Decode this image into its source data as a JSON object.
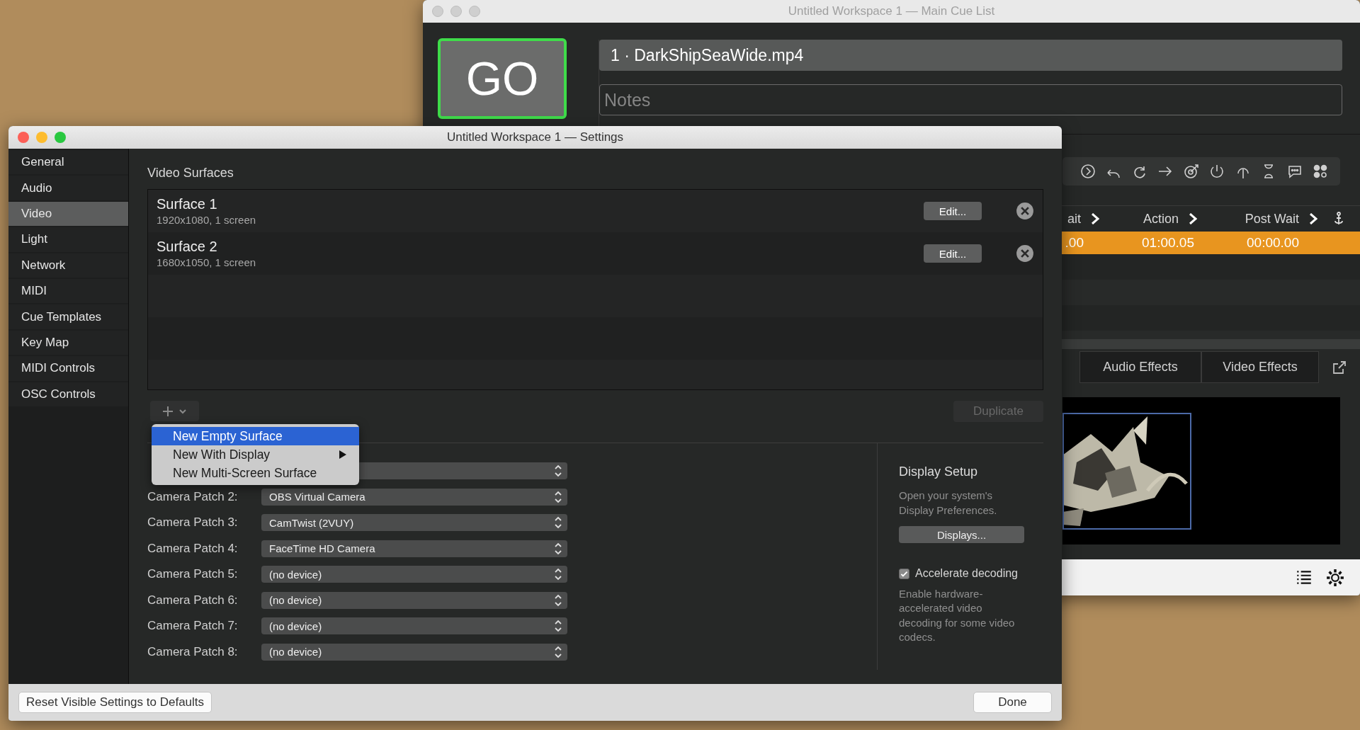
{
  "main_window": {
    "title": "Untitled Workspace 1 — Main Cue List",
    "go_label": "GO",
    "cue_name": "1 · DarkShipSeaWide.mp4",
    "notes_placeholder": "Notes",
    "columns": [
      "ait",
      "Action",
      "Post Wait"
    ],
    "cue_row": {
      "selected": true,
      "cells": [
        ".00",
        "01:00.05",
        "00:00.00"
      ]
    },
    "inspector_tabs": [
      {
        "label": "Audio Effects",
        "selected": false
      },
      {
        "label": "Video Effects",
        "selected": false
      }
    ]
  },
  "settings_window": {
    "title": "Untitled Workspace 1 — Settings",
    "sidebar": [
      {
        "label": "General",
        "selected": false
      },
      {
        "label": "Audio",
        "selected": false
      },
      {
        "label": "Video",
        "selected": true
      },
      {
        "label": "Light",
        "selected": false
      },
      {
        "label": "Network",
        "selected": false
      },
      {
        "label": "MIDI",
        "selected": false
      },
      {
        "label": "Cue Templates",
        "selected": false
      },
      {
        "label": "Key Map",
        "selected": false
      },
      {
        "label": "MIDI Controls",
        "selected": false
      },
      {
        "label": "OSC Controls",
        "selected": false
      }
    ],
    "section_title": "Video Surfaces",
    "surfaces": [
      {
        "name": "Surface 1",
        "detail": "1920x1080, 1 screen",
        "edit_label": "Edit..."
      },
      {
        "name": "Surface 2",
        "detail": "1680x1050, 1 screen",
        "edit_label": "Edit..."
      }
    ],
    "duplicate": {
      "label": "Duplicate",
      "disabled": true
    },
    "add_menu": [
      {
        "label": "New Empty Surface",
        "selected": true,
        "submenu": false
      },
      {
        "label": "New With Display",
        "selected": false,
        "submenu": true
      },
      {
        "label": "New Multi-Screen Surface",
        "selected": false,
        "submenu": false
      }
    ],
    "camera_patches": [
      {
        "label": "Camera Patch 2:",
        "value": "OBS Virtual Camera"
      },
      {
        "label": "Camera Patch 3:",
        "value": "CamTwist (2VUY)"
      },
      {
        "label": "Camera Patch 4:",
        "value": "FaceTime HD Camera"
      },
      {
        "label": "Camera Patch 5:",
        "value": "(no device)"
      },
      {
        "label": "Camera Patch 6:",
        "value": "(no device)"
      },
      {
        "label": "Camera Patch 7:",
        "value": "(no device)"
      },
      {
        "label": "Camera Patch 8:",
        "value": "(no device)"
      }
    ],
    "display_setup": {
      "title": "Display Setup",
      "description": "Open your system's Display Preferences.",
      "button": "Displays...",
      "checkbox": {
        "label": "Accelerate decoding",
        "checked": true
      },
      "hint": "Enable hardware-accelerated video decoding for some video codecs."
    },
    "reset_button": "Reset Visible Settings to Defaults",
    "done_button": "Done"
  }
}
